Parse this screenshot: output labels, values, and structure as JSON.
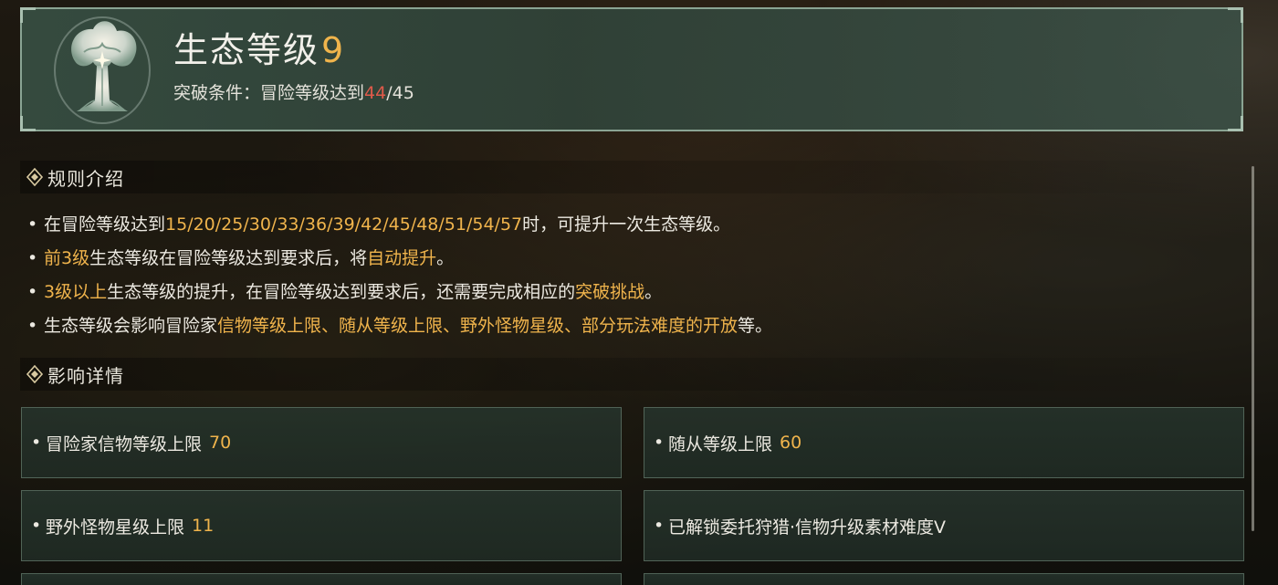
{
  "header": {
    "title": "生态等级",
    "level": "9",
    "condition_label": "突破条件：冒险等级达到",
    "condition_current": "44",
    "condition_sep": "/",
    "condition_target": "45",
    "emblem_icon": "tree-emblem-icon"
  },
  "rules_section": {
    "heading": "规则介绍",
    "items": [
      {
        "parts": [
          {
            "t": "在冒险等级达到",
            "h": false
          },
          {
            "t": "15/20/25/30/33/36/39/42/45/48/51/54/57",
            "h": true
          },
          {
            "t": "时，可提升一次生态等级。",
            "h": false
          }
        ]
      },
      {
        "parts": [
          {
            "t": "前3级",
            "h": true
          },
          {
            "t": "生态等级在冒险等级达到要求后，将",
            "h": false
          },
          {
            "t": "自动提升",
            "h": true
          },
          {
            "t": "。",
            "h": false
          }
        ]
      },
      {
        "parts": [
          {
            "t": "3级以上",
            "h": true
          },
          {
            "t": "生态等级的提升，在冒险等级达到要求后，还需要完成相应的",
            "h": false
          },
          {
            "t": "突破挑战",
            "h": true
          },
          {
            "t": "。",
            "h": false
          }
        ]
      },
      {
        "parts": [
          {
            "t": "生态等级会影响冒险家",
            "h": false
          },
          {
            "t": "信物等级上限、随从等级上限、野外怪物星级、部分玩法难度的开放",
            "h": true
          },
          {
            "t": "等。",
            "h": false
          }
        ]
      }
    ]
  },
  "impact_section": {
    "heading": "影响详情",
    "cards": [
      {
        "label": "冒险家信物等级上限",
        "value": "70"
      },
      {
        "label": "随从等级上限",
        "value": "60"
      },
      {
        "label": "野外怪物星级上限",
        "value": "11"
      },
      {
        "label": "已解锁委托狩猎·信物升级素材难度V",
        "value": ""
      }
    ]
  },
  "colors": {
    "accent_gold": "#f0b44c",
    "accent_red": "#e05a4a",
    "panel_border": "#8aa493"
  }
}
